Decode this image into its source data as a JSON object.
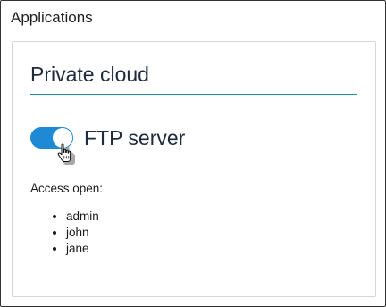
{
  "window": {
    "title": "Applications"
  },
  "panel": {
    "title": "Private cloud",
    "toggle": {
      "label": "FTP server",
      "on": true,
      "accent_color": "#1e8ad6"
    },
    "access": {
      "heading": "Access open:",
      "users": [
        "admin",
        "john",
        "jane"
      ]
    },
    "divider_color": "#1a8fa3"
  },
  "cursor": {
    "icon": "hand-pointer-icon"
  }
}
